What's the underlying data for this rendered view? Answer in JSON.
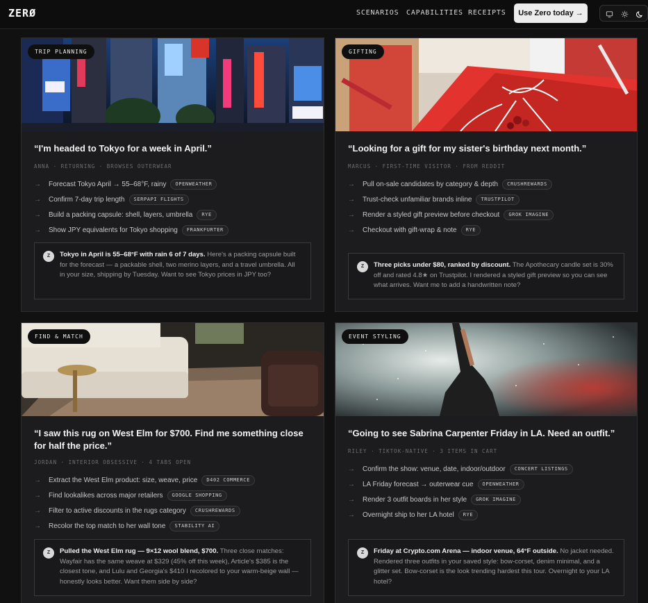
{
  "header": {
    "logo": "ZERØ",
    "nav": [
      "SCENARIOS",
      "CAPABILITIES",
      "RECEIPTS"
    ],
    "cta": "Use Zero today →",
    "theme_icons": [
      "monitor-icon",
      "sun-icon",
      "moon-icon"
    ]
  },
  "cards": [
    {
      "tag": "TRIP PLANNING",
      "quote": "“I'm headed to Tokyo for a week in April.”",
      "meta": "ANNA · RETURNING · BROWSES OUTERWEAR",
      "steps": [
        {
          "text": "Forecast Tokyo April → 55–68°F, rainy",
          "chip": "OPENWEATHER"
        },
        {
          "text": "Confirm 7-day trip length",
          "chip": "SERPAPI FLIGHTS"
        },
        {
          "text": "Build a packing capsule: shell, layers, umbrella",
          "chip": "RYE"
        },
        {
          "text": "Show JPY equivalents for Tokyo shopping",
          "chip": "FRANKFURTER"
        }
      ],
      "reply_avatar": "Z",
      "reply_bold": "Tokyo in April is 55–68°F with rain 6 of 7 days.",
      "reply_text": " Here's a packing capsule built for the forecast — a packable shell, two merino layers, and a travel umbrella. All in your size, shipping by Tuesday. Want to see Tokyo prices in JPY too?"
    },
    {
      "tag": "GIFTING",
      "quote": "“Looking for a gift for my sister's birthday next month.”",
      "meta": "MARCUS · FIRST-TIME VISITOR · FROM REDDIT",
      "steps": [
        {
          "text": "Pull on-sale candidates by category & depth",
          "chip": "CRUSHREWARDS"
        },
        {
          "text": "Trust-check unfamiliar brands inline",
          "chip": "TRUSTPILOT"
        },
        {
          "text": "Render a styled gift preview before checkout",
          "chip": "GROK IMAGINE"
        },
        {
          "text": "Checkout with gift-wrap & note",
          "chip": "RYE"
        }
      ],
      "reply_avatar": "Z",
      "reply_bold": "Three picks under $80, ranked by discount.",
      "reply_text": " The Apothecary candle set is 30% off and rated 4.8★ on Trustpilot. I rendered a styled gift preview so you can see what arrives. Want me to add a handwritten note?"
    },
    {
      "tag": "FIND & MATCH",
      "quote": "“I saw this rug on West Elm for $700. Find me something close for half the price.”",
      "meta": "JORDAN · INTERIOR OBSESSIVE · 4 TABS OPEN",
      "steps": [
        {
          "text": "Extract the West Elm product: size, weave, price",
          "chip": "D402 COMMERCE"
        },
        {
          "text": "Find lookalikes across major retailers",
          "chip": "GOOGLE SHOPPING"
        },
        {
          "text": "Filter to active discounts in the rugs category",
          "chip": "CRUSHREWARDS"
        },
        {
          "text": "Recolor the top match to her wall tone",
          "chip": "STABILITY AI"
        }
      ],
      "reply_avatar": "Z",
      "reply_bold": "Pulled the West Elm rug — 9×12 wool blend, $700.",
      "reply_text": " Three close matches: Wayfair has the same weave at $329 (45% off this week), Article's $385 is the closest tone, and Lulu and Georgia's $410 I recolored to your warm-beige wall — honestly looks better. Want them side by side?"
    },
    {
      "tag": "EVENT STYLING",
      "quote": "“Going to see Sabrina Carpenter Friday in LA. Need an outfit.”",
      "meta": "RILEY · TIKTOK-NATIVE · 3 ITEMS IN CART",
      "steps": [
        {
          "text": "Confirm the show: venue, date, indoor/outdoor",
          "chip": "CONCERT LISTINGS"
        },
        {
          "text": "LA Friday forecast → outerwear cue",
          "chip": "OPENWEATHER"
        },
        {
          "text": "Render 3 outfit boards in her style",
          "chip": "GROK IMAGINE"
        },
        {
          "text": "Overnight ship to her LA hotel",
          "chip": "RYE"
        }
      ],
      "reply_avatar": "Z",
      "reply_bold": "Friday at Crypto.com Arena — indoor venue, 64°F outside.",
      "reply_text": " No jacket needed. Rendered three outfits in your saved style: bow-corset, denim minimal, and a glitter set. Bow-corset is the look trending hardest this tour. Overnight to your LA hotel?"
    }
  ]
}
